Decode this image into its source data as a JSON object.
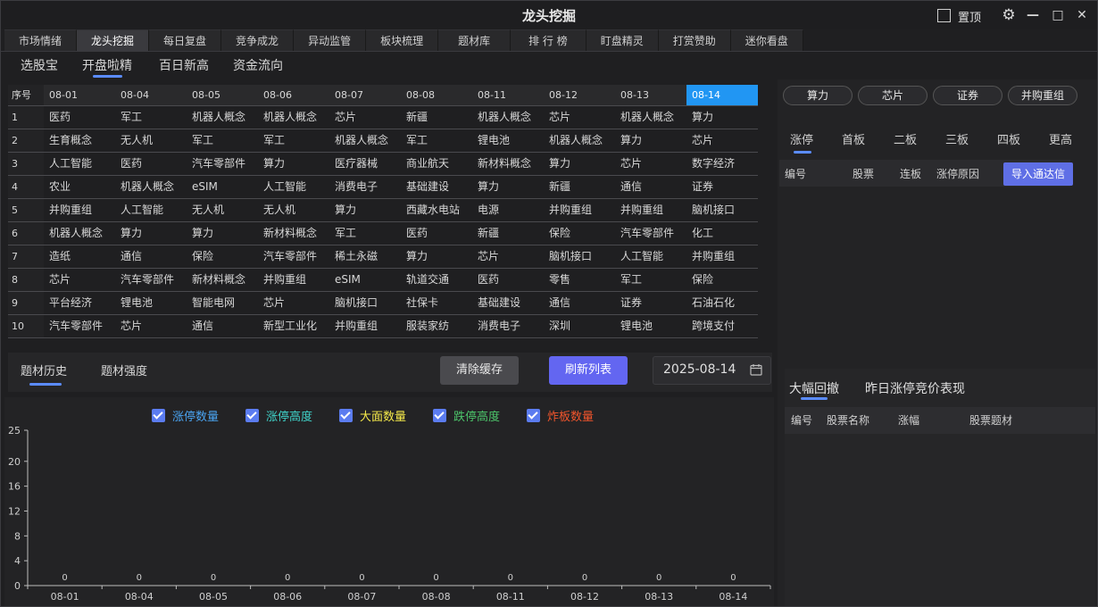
{
  "window": {
    "title": "龙头挖掘",
    "pin_label": "置顶",
    "controls": [
      "⚙",
      "—",
      "□",
      "✕"
    ]
  },
  "main_tabs": [
    {
      "label": "市场情绪",
      "active": false
    },
    {
      "label": "龙头挖掘",
      "active": true
    },
    {
      "label": "每日复盘",
      "active": false
    },
    {
      "label": "竞争成龙",
      "active": false
    },
    {
      "label": "异动监管",
      "active": false
    },
    {
      "label": "板块梳理",
      "active": false
    },
    {
      "label": "题材库",
      "active": false
    },
    {
      "label": "排 行 榜",
      "active": false
    },
    {
      "label": "盯盘精灵",
      "active": false
    },
    {
      "label": "打赏赞助",
      "active": false
    },
    {
      "label": "迷你看盘",
      "active": false
    }
  ],
  "sub_tabs": [
    {
      "label": "选股宝",
      "active": false
    },
    {
      "label": "开盘啦精",
      "active": true
    },
    {
      "label": "百日新高",
      "active": false
    },
    {
      "label": "资金流向",
      "active": false
    }
  ],
  "grid": {
    "index_header": "序号",
    "dates": [
      "08-01",
      "08-04",
      "08-05",
      "08-06",
      "08-07",
      "08-08",
      "08-11",
      "08-12",
      "08-13",
      "08-14"
    ],
    "highlight_col": 9,
    "rows": [
      {
        "idx": "1",
        "cells": [
          "医药",
          "军工",
          "机器人概念",
          "机器人概念",
          "芯片",
          "新疆",
          "机器人概念",
          "芯片",
          "机器人概念",
          "算力"
        ]
      },
      {
        "idx": "2",
        "cells": [
          "生育概念",
          "无人机",
          "军工",
          "军工",
          "机器人概念",
          "军工",
          "锂电池",
          "机器人概念",
          "算力",
          "芯片"
        ]
      },
      {
        "idx": "3",
        "cells": [
          "人工智能",
          "医药",
          "汽车零部件",
          "算力",
          "医疗器械",
          "商业航天",
          "新材料概念",
          "算力",
          "芯片",
          "数字经济"
        ]
      },
      {
        "idx": "4",
        "cells": [
          "农业",
          "机器人概念",
          "eSIM",
          "人工智能",
          "消费电子",
          "基础建设",
          "算力",
          "新疆",
          "通信",
          "证券"
        ]
      },
      {
        "idx": "5",
        "cells": [
          "并购重组",
          "人工智能",
          "无人机",
          "无人机",
          "算力",
          "西藏水电站",
          "电源",
          "并购重组",
          "并购重组",
          "脑机接口"
        ]
      },
      {
        "idx": "6",
        "cells": [
          "机器人概念",
          "算力",
          "算力",
          "新材料概念",
          "军工",
          "医药",
          "新疆",
          "保险",
          "汽车零部件",
          "化工"
        ]
      },
      {
        "idx": "7",
        "cells": [
          "造纸",
          "通信",
          "保险",
          "汽车零部件",
          "稀土永磁",
          "算力",
          "芯片",
          "脑机接口",
          "人工智能",
          "并购重组"
        ]
      },
      {
        "idx": "8",
        "cells": [
          "芯片",
          "汽车零部件",
          "新材料概念",
          "并购重组",
          "eSIM",
          "轨道交通",
          "医药",
          "零售",
          "军工",
          "保险"
        ]
      },
      {
        "idx": "9",
        "cells": [
          "平台经济",
          "锂电池",
          "智能电网",
          "芯片",
          "脑机接口",
          "社保卡",
          "基础建设",
          "通信",
          "证券",
          "石油石化"
        ]
      },
      {
        "idx": "10",
        "cells": [
          "汽车零部件",
          "芯片",
          "通信",
          "新型工业化",
          "并购重组",
          "服装家纺",
          "消费电子",
          "深圳",
          "锂电池",
          "跨境支付"
        ]
      }
    ]
  },
  "right": {
    "pills": [
      "算力",
      "芯片",
      "证券",
      "并购重组"
    ],
    "zt_tabs": [
      "涨停",
      "首板",
      "二板",
      "三板",
      "四板",
      "更高"
    ],
    "zt_columns": [
      "编号",
      "股票",
      "连板",
      "涨停原因"
    ],
    "import_button": "导入通达信",
    "lower_tabs": [
      "大幅回撤",
      "昨日涨停竞价表现"
    ],
    "lower_columns": [
      "编号",
      "股票名称",
      "涨幅",
      "股票题材"
    ]
  },
  "bottom": {
    "tabs": [
      "题材历史",
      "题材强度"
    ],
    "clear_button": "清除缓存",
    "refresh_button": "刷新列表",
    "date": "2025-08-14"
  },
  "chart_data": {
    "type": "bar",
    "categories": [
      "08-01",
      "08-04",
      "08-05",
      "08-06",
      "08-07",
      "08-08",
      "08-11",
      "08-12",
      "08-13",
      "08-14"
    ],
    "series": [
      {
        "name": "涨停数量",
        "color": "#4aa3f0",
        "values": [
          0,
          0,
          0,
          0,
          0,
          0,
          0,
          0,
          0,
          0
        ]
      },
      {
        "name": "涨停高度",
        "color": "#3fd1c8",
        "values": [
          0,
          0,
          0,
          0,
          0,
          0,
          0,
          0,
          0,
          0
        ]
      },
      {
        "name": "大面数量",
        "color": "#f5e94a",
        "values": [
          0,
          0,
          0,
          0,
          0,
          0,
          0,
          0,
          0,
          0
        ]
      },
      {
        "name": "跌停高度",
        "color": "#4cc46a",
        "values": [
          0,
          0,
          0,
          0,
          0,
          0,
          0,
          0,
          0,
          0
        ]
      },
      {
        "name": "炸板数量",
        "color": "#f2552c",
        "values": [
          0,
          0,
          0,
          0,
          0,
          0,
          0,
          0,
          0,
          0
        ]
      }
    ],
    "ylim": [
      0,
      25
    ],
    "yticks": [
      0,
      4,
      8,
      12,
      16,
      20,
      25
    ],
    "point_label": "0"
  }
}
